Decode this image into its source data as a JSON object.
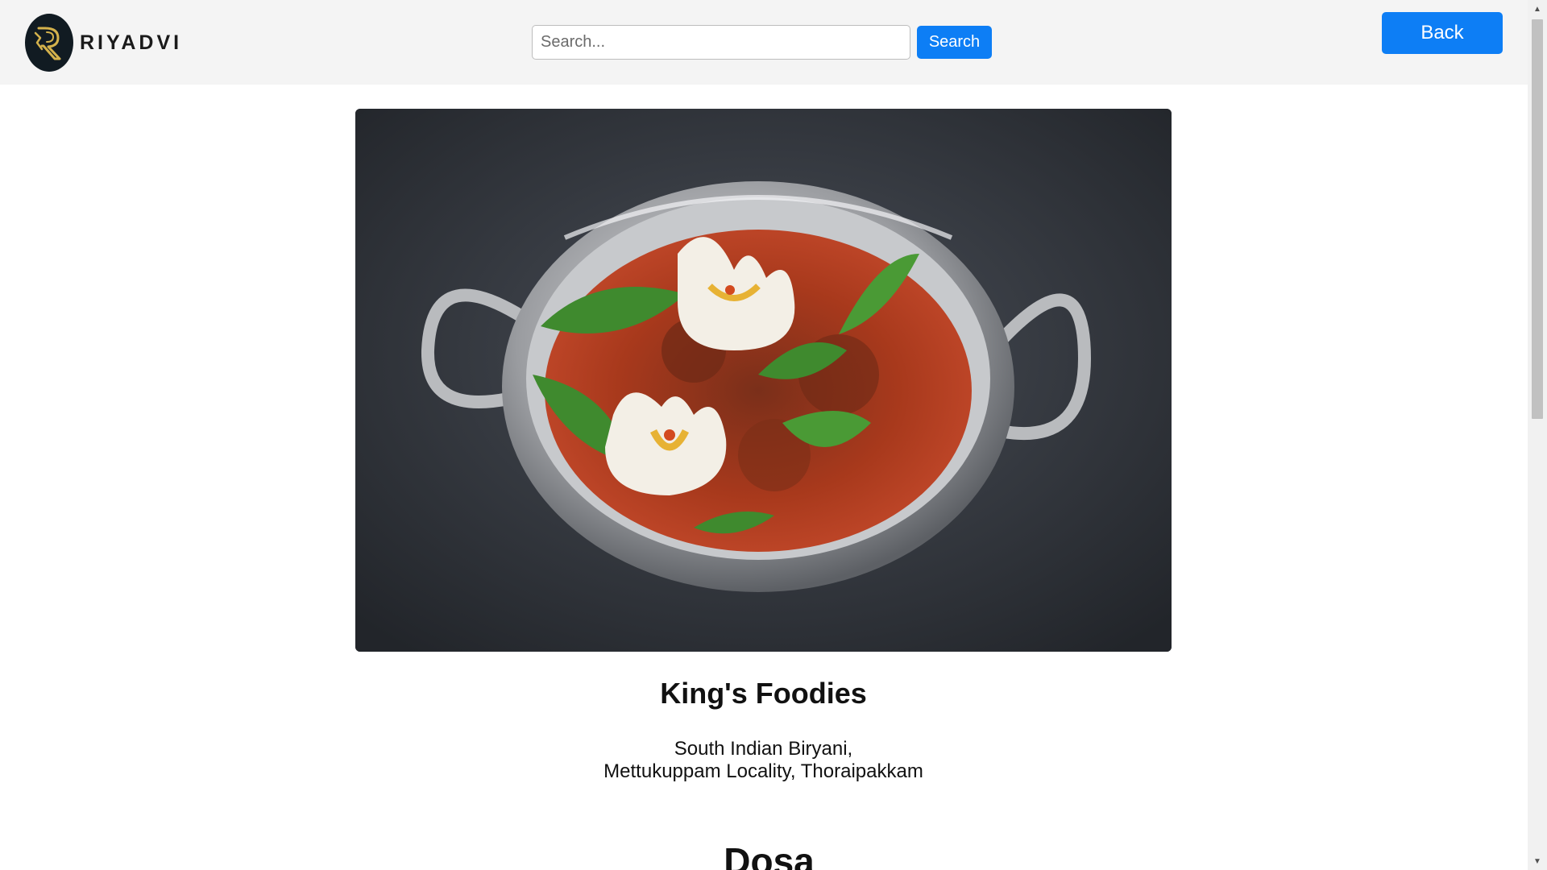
{
  "brand": {
    "name": "RIYADVI",
    "logo_icon": "riyadvi-logo-icon",
    "accent": "#d4b24c"
  },
  "search": {
    "placeholder": "Search...",
    "value": "",
    "button_label": "Search"
  },
  "nav": {
    "back_label": "Back"
  },
  "colors": {
    "primary_button": "#0d7ef5",
    "header_bg": "#f4f4f4",
    "page_bg": "#ffffff"
  },
  "restaurant": {
    "name": "King's Foodies",
    "cuisine": "South Indian Biryani,",
    "locality": "Mettukuppam Locality, Thoraipakkam"
  },
  "menu": {
    "section_title": "Dosa"
  }
}
